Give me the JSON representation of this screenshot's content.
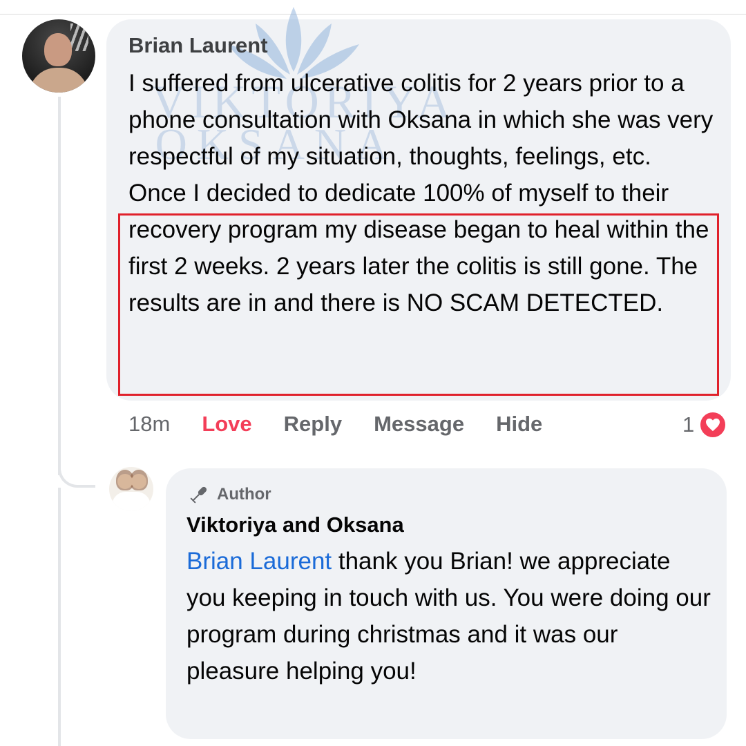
{
  "comment": {
    "author": "Brian Laurent",
    "text": "I suffered from ulcerative colitis for 2 years prior to a phone consultation with Oksana in which she was very respectful of my situation, thoughts, feelings, etc. Once I decided to dedicate 100% of myself to their recovery program my disease began to heal within the first 2 weeks. 2 years later the colitis is still gone. The results are in and there is NO SCAM DETECTED.",
    "timestamp": "18m",
    "actions": {
      "love": "Love",
      "reply": "Reply",
      "message": "Message",
      "hide": "Hide"
    },
    "reaction_count": "1",
    "reaction_icon": "heart-icon"
  },
  "reply": {
    "badge": "Author",
    "badge_icon": "microphone-icon",
    "author": "Viktoriya and Oksana",
    "mention": "Brian Laurent",
    "text": " thank you Brian! we appreciate you keeping in touch with us. You were doing our program during christmas and it was our pleasure helping you!"
  },
  "watermark": {
    "line1": "VIKTORIYA",
    "line2": "OKSANA"
  },
  "colors": {
    "love": "#f33e58",
    "mention": "#1b6bd8",
    "highlight": "#e0212b",
    "bubble": "#f0f2f5",
    "watermark": "#7fa8d8"
  }
}
